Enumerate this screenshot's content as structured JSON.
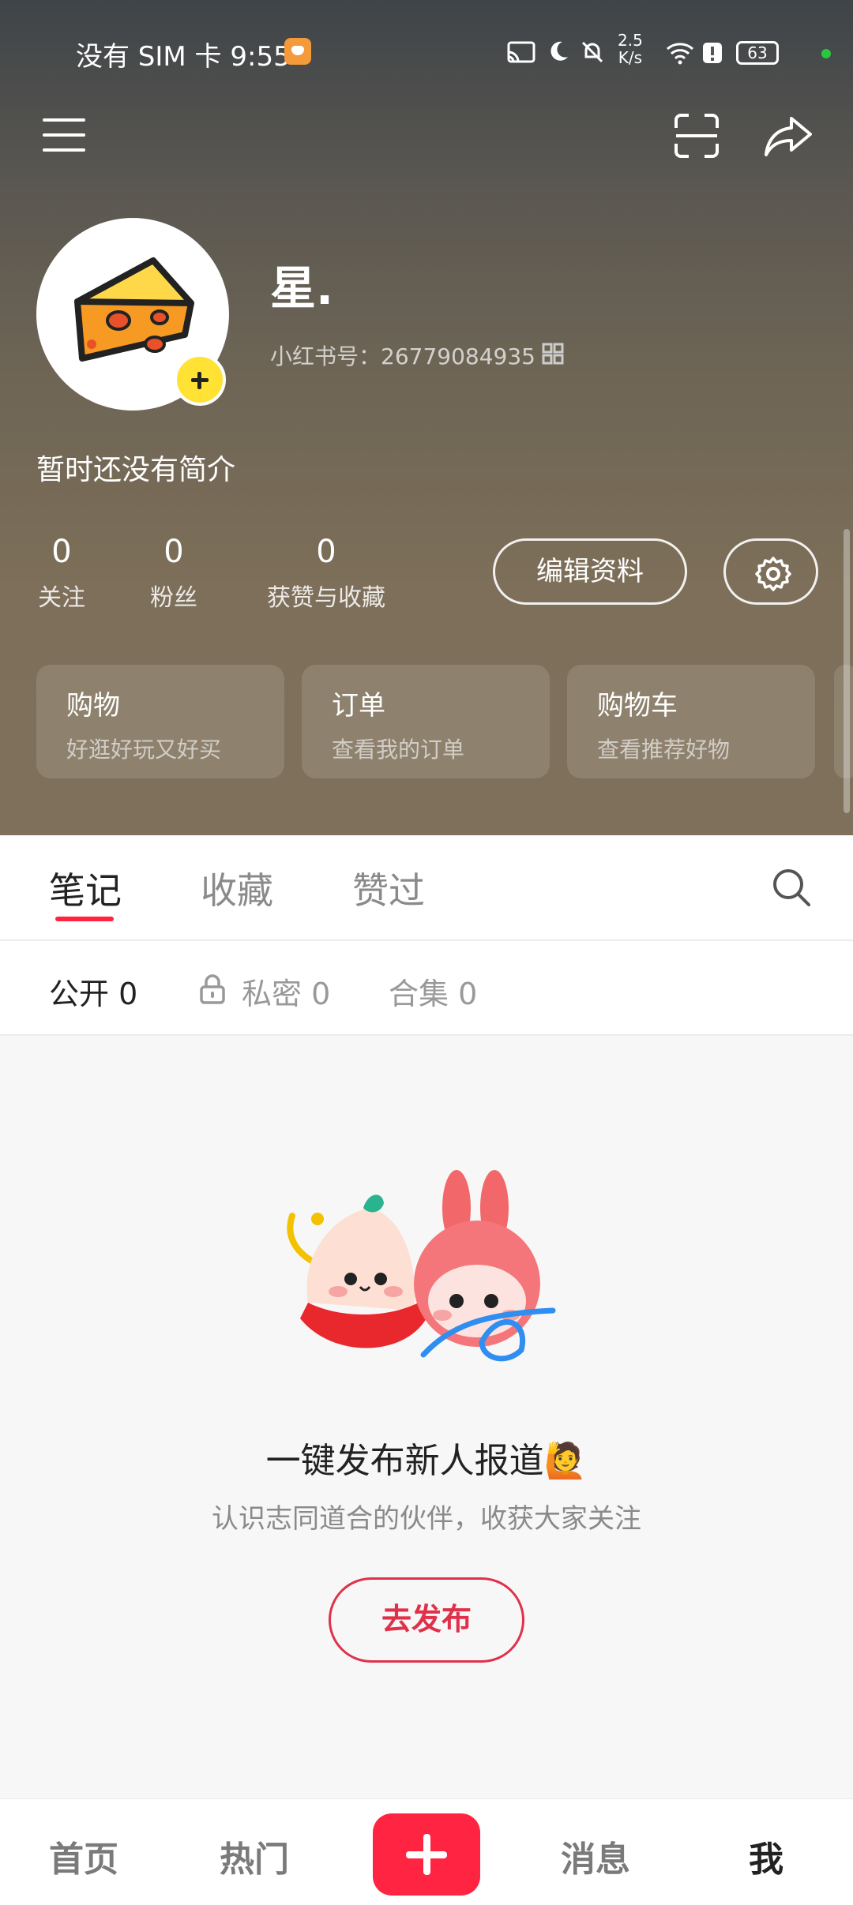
{
  "status_bar": {
    "left_text": "没有 SIM 卡 9:55",
    "net_speed_value": "2.5",
    "net_speed_unit": "K/s",
    "battery": "63"
  },
  "profile": {
    "name": "星.",
    "id_text": "小红书号：26779084935",
    "bio": "暂时还没有简介"
  },
  "stats": [
    {
      "num": "0",
      "label": "关注"
    },
    {
      "num": "0",
      "label": "粉丝"
    },
    {
      "num": "0",
      "label": "获赞与收藏"
    }
  ],
  "edit_button": "编辑资料",
  "cards": [
    {
      "title": "购物",
      "subtitle": "好逛好玩又好买"
    },
    {
      "title": "订单",
      "subtitle": "查看我的订单"
    },
    {
      "title": "购物车",
      "subtitle": "查看推荐好物"
    }
  ],
  "tabs": [
    "笔记",
    "收藏",
    "赞过"
  ],
  "subtabs": [
    "公开 0",
    "私密 0",
    "合集 0"
  ],
  "empty_state": {
    "title": "一键发布新人报道🙋",
    "subtitle": "认识志同道合的伙伴，收获大家关注",
    "button": "去发布"
  },
  "bottom_nav": [
    "首页",
    "热门",
    "消息",
    "我"
  ],
  "colors": {
    "accent": "#ff2442",
    "header": "#6e6555"
  }
}
